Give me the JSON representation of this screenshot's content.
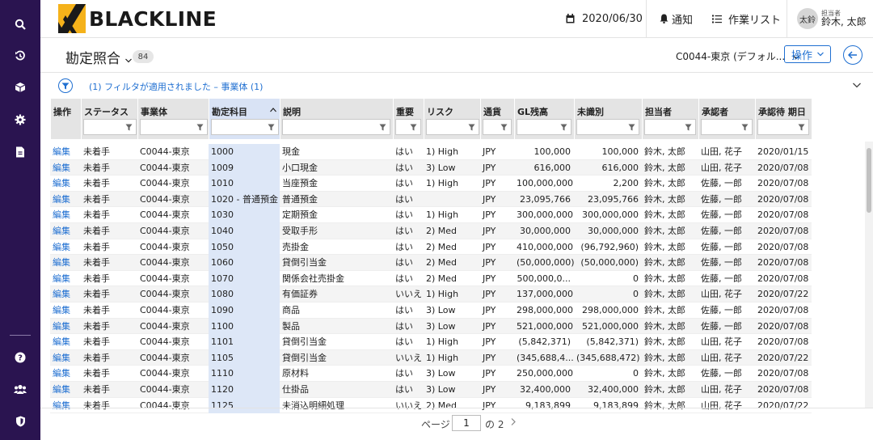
{
  "sidebar": {
    "icons": [
      "search-icon",
      "history-icon",
      "cube-icon",
      "gear-icon",
      "document-icon",
      "help-icon",
      "users-icon",
      "shield-icon"
    ]
  },
  "header": {
    "brand": "BLACKLINE",
    "date": "2020/06/30",
    "notifications": "通知",
    "tasks": "作業リスト",
    "avatar_initials": "太鈴",
    "user_role": "担当者",
    "user_name": "鈴木, 太郎"
  },
  "page": {
    "title": "勘定照合",
    "count": "84",
    "entity_select": "C0044-東京 (デフォル...",
    "action_button": "操作"
  },
  "filter": {
    "text": "(1) フィルタが適用されました – 事業体 (1)"
  },
  "table": {
    "columns": [
      {
        "key": "edit",
        "label": "操作",
        "filter": false
      },
      {
        "key": "status",
        "label": "ステータス",
        "filter": true
      },
      {
        "key": "entity",
        "label": "事業体",
        "filter": true
      },
      {
        "key": "account",
        "label": "勘定科目",
        "filter": true,
        "sorted": "asc"
      },
      {
        "key": "desc",
        "label": "説明",
        "filter": true
      },
      {
        "key": "important",
        "label": "重要",
        "filter": true
      },
      {
        "key": "risk",
        "label": "リスク",
        "filter": true
      },
      {
        "key": "currency",
        "label": "通貨",
        "filter": true
      },
      {
        "key": "gl",
        "label": "GL残高",
        "filter": true
      },
      {
        "key": "unidentified",
        "label": "未識別",
        "filter": true
      },
      {
        "key": "assignee",
        "label": "担当者",
        "filter": true
      },
      {
        "key": "approver",
        "label": "承認者",
        "filter": true
      },
      {
        "key": "due",
        "label": "承認待 期日",
        "filter": true
      }
    ],
    "rows": [
      [
        "編集",
        "未着手",
        "C0044-東京",
        "1000",
        "現金",
        "はい",
        "1) High",
        "JPY",
        "100,000",
        "100,000",
        "鈴木, 太郎",
        "山田, 花子",
        "2020/01/15"
      ],
      [
        "編集",
        "未着手",
        "C0044-東京",
        "1009",
        "小口現金",
        "はい",
        "3) Low",
        "JPY",
        "616,000",
        "616,000",
        "鈴木, 太郎",
        "山田, 花子",
        "2020/07/08"
      ],
      [
        "編集",
        "未着手",
        "C0044-東京",
        "1010",
        "当座預金",
        "はい",
        "1) High",
        "JPY",
        "100,000,000",
        "2,200",
        "鈴木, 太郎",
        "佐藤, 一郎",
        "2020/07/08"
      ],
      [
        "編集",
        "未着手",
        "C0044-東京",
        "1020 - 普通預金",
        "普通預金",
        "はい",
        "",
        "JPY",
        "23,095,766",
        "23,095,766",
        "鈴木, 太郎",
        "佐藤, 一郎",
        "2020/07/08"
      ],
      [
        "編集",
        "未着手",
        "C0044-東京",
        "1030",
        "定期預金",
        "はい",
        "1) High",
        "JPY",
        "300,000,000",
        "300,000,000",
        "鈴木, 太郎",
        "佐藤, 一郎",
        "2020/07/08"
      ],
      [
        "編集",
        "未着手",
        "C0044-東京",
        "1040",
        "受取手形",
        "はい",
        "2) Med",
        "JPY",
        "30,000,000",
        "30,000,000",
        "鈴木, 太郎",
        "佐藤, 一郎",
        "2020/07/08"
      ],
      [
        "編集",
        "未着手",
        "C0044-東京",
        "1050",
        "売掛金",
        "はい",
        "2) Med",
        "JPY",
        "410,000,000",
        "(96,792,960)",
        "鈴木, 太郎",
        "佐藤, 一郎",
        "2020/07/08"
      ],
      [
        "編集",
        "未着手",
        "C0044-東京",
        "1060",
        "貸倒引当金",
        "はい",
        "2) Med",
        "JPY",
        "(50,000,000)",
        "(50,000,000)",
        "鈴木, 太郎",
        "佐藤, 一郎",
        "2020/07/08"
      ],
      [
        "編集",
        "未着手",
        "C0044-東京",
        "1070",
        "関係会社売掛金",
        "はい",
        "2) Med",
        "JPY",
        "500,000,0...",
        "0",
        "鈴木, 太郎",
        "佐藤, 一郎",
        "2020/07/08"
      ],
      [
        "編集",
        "未着手",
        "C0044-東京",
        "1080",
        "有価証券",
        "いいえ",
        "1) High",
        "JPY",
        "137,000,000",
        "0",
        "鈴木, 太郎",
        "山田, 花子",
        "2020/07/22"
      ],
      [
        "編集",
        "未着手",
        "C0044-東京",
        "1090",
        "商品",
        "はい",
        "3) Low",
        "JPY",
        "298,000,000",
        "298,000,000",
        "鈴木, 太郎",
        "佐藤, 一郎",
        "2020/07/08"
      ],
      [
        "編集",
        "未着手",
        "C0044-東京",
        "1100",
        "製品",
        "はい",
        "3) Low",
        "JPY",
        "521,000,000",
        "521,000,000",
        "鈴木, 太郎",
        "佐藤, 一郎",
        "2020/07/08"
      ],
      [
        "編集",
        "未着手",
        "C0044-東京",
        "1101",
        "貸倒引当金",
        "はい",
        "1) High",
        "JPY",
        "(5,842,371)",
        "(5,842,371)",
        "鈴木, 太郎",
        "山田, 花子",
        "2020/07/08"
      ],
      [
        "編集",
        "未着手",
        "C0044-東京",
        "1105",
        "貸倒引当金",
        "いいえ",
        "1) High",
        "JPY",
        "(345,688,4...",
        "(345,688,472)",
        "鈴木, 太郎",
        "山田, 花子",
        "2020/07/22"
      ],
      [
        "編集",
        "未着手",
        "C0044-東京",
        "1110",
        "原材料",
        "はい",
        "3) Low",
        "JPY",
        "250,000,000",
        "0",
        "鈴木, 太郎",
        "佐藤, 一郎",
        "2020/07/08"
      ],
      [
        "編集",
        "未着手",
        "C0044-東京",
        "1120",
        "仕掛品",
        "はい",
        "3) Low",
        "JPY",
        "32,400,000",
        "32,400,000",
        "鈴木, 太郎",
        "山田, 花子",
        "2020/07/08"
      ],
      [
        "編集",
        "未着手",
        "C0044-東京",
        "1125",
        "未消込明細処理",
        "いいえ",
        "2) Med",
        "JPY",
        "9,183,899",
        "9,183,899",
        "鈴木, 太郎",
        "山田, 花子",
        "2020/07/22"
      ]
    ]
  },
  "pager": {
    "label": "ページ",
    "current": "1",
    "total": "の 2"
  },
  "colors": {
    "brand_purple": "#2a1450",
    "link_blue": "#1f6fd1",
    "logo_gold": "#f5b21a"
  }
}
